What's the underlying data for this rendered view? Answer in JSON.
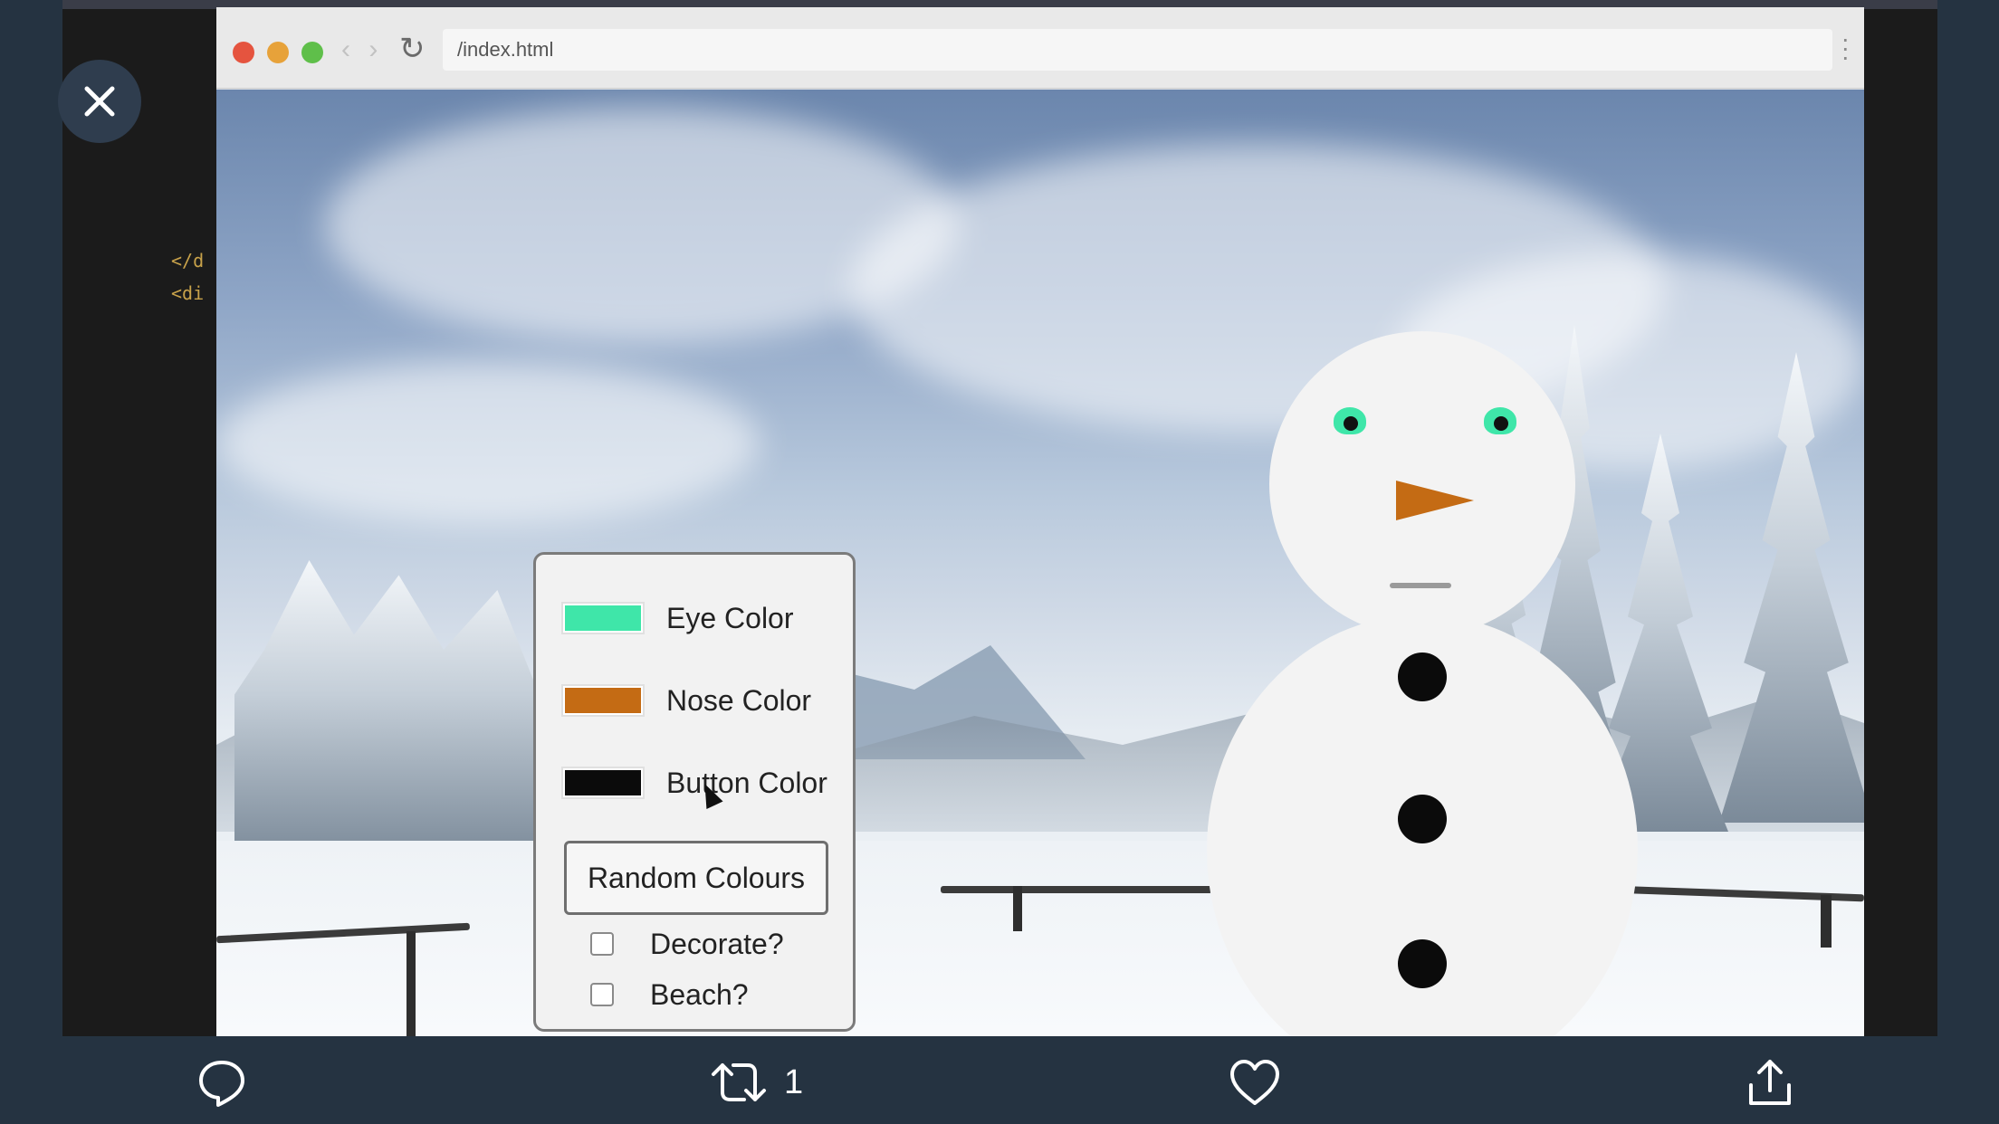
{
  "browser": {
    "url": "/index.html"
  },
  "code_peek": {
    "lines": [
      "</d",
      "<di"
    ]
  },
  "snowman": {
    "eye_color": "#3fe6a9",
    "nose_color": "#c46b14",
    "button_color": "#0b0b0b"
  },
  "controls": {
    "eye_label": "Eye Color",
    "nose_label": "Nose Color",
    "button_label": "Button Color",
    "random_button": "Random Colours",
    "decorate_label": "Decorate?",
    "beach_label": "Beach?"
  },
  "tweet_actions": {
    "retweet_count": "1",
    "icons": [
      "reply-icon",
      "retweet-icon",
      "like-icon",
      "share-icon"
    ]
  }
}
